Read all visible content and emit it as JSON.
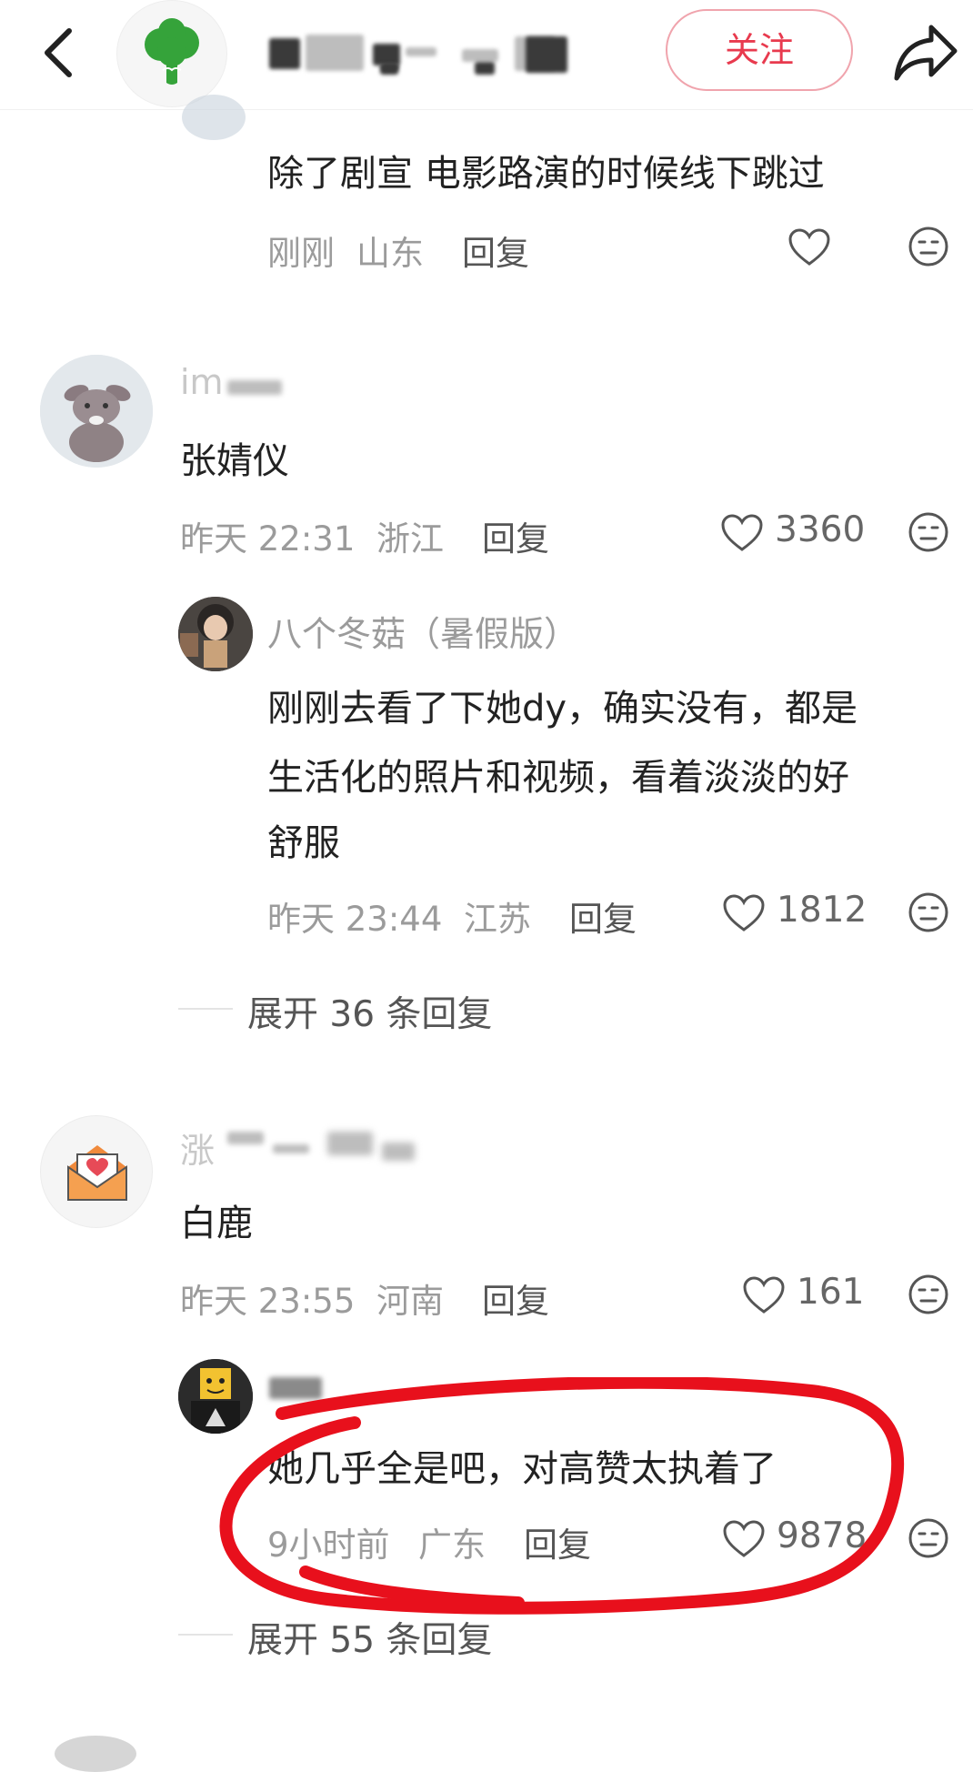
{
  "header": {
    "title": "",
    "follow_label": "关注",
    "icons": {
      "back": "chevron-left-icon",
      "share": "share-arrow-icon",
      "avatar": "broccoli-logo"
    }
  },
  "comments": [
    {
      "content": "除了剧宣 电影路演的时候线下跳过",
      "time": "刚刚",
      "region": "山东",
      "reply_label": "回复",
      "likes": ""
    },
    {
      "username": "im",
      "content": "张婧仪",
      "time": "昨天 22:31",
      "region": "浙江",
      "reply_label": "回复",
      "likes": "3360",
      "replies": [
        {
          "username": "八个冬菇（暑假版）",
          "content_lines": [
            "刚刚去看了下她dy，确实没有，都是",
            "生活化的照片和视频，看着淡淡的好",
            "舒服"
          ],
          "time": "昨天 23:44",
          "region": "江苏",
          "reply_label": "回复",
          "likes": "1812"
        }
      ],
      "expand_label": "展开 36 条回复"
    },
    {
      "username": "涨",
      "content": "白鹿",
      "time": "昨天 23:55",
      "region": "河南",
      "reply_label": "回复",
      "likes": "161",
      "replies": [
        {
          "username": "",
          "content_lines": [
            "她几乎全是吧，对高赞太执着了"
          ],
          "time": "9小时前",
          "region": "广东",
          "reply_label": "回复",
          "likes": "9878"
        }
      ],
      "expand_label": "展开 55 条回复"
    }
  ],
  "colors": {
    "accent": "#e83a4e",
    "annotation": "#e8101c",
    "meta_text": "#9b9b9b"
  }
}
